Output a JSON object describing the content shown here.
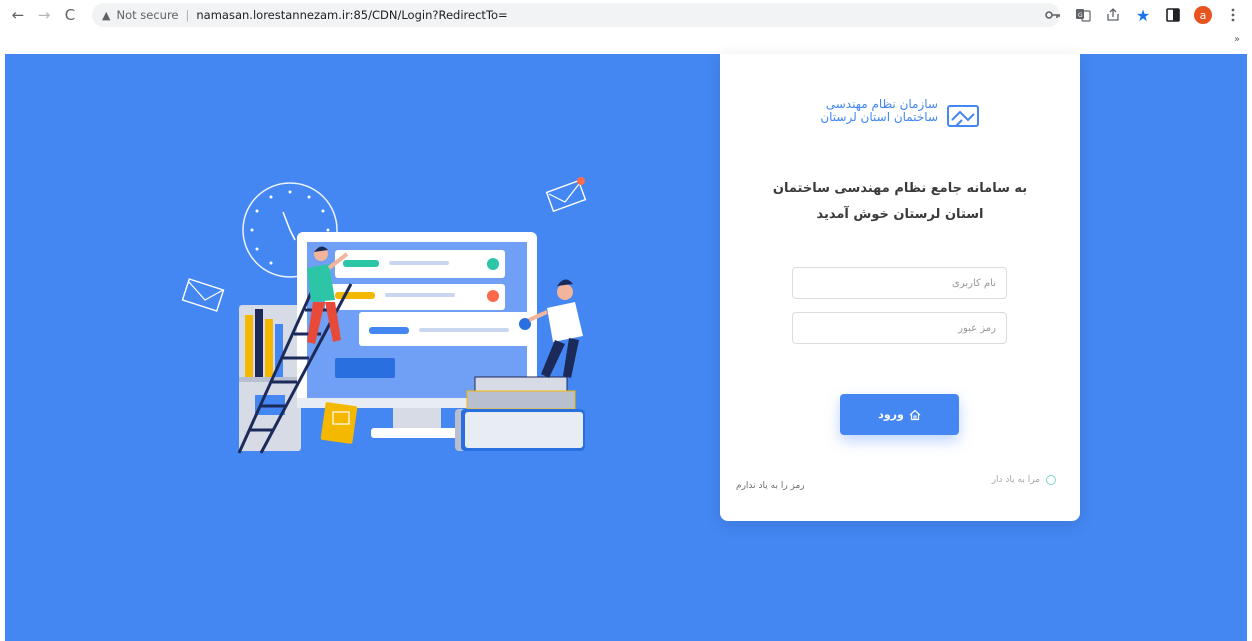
{
  "browser": {
    "back_icon": "←",
    "forward_icon": "→",
    "reload_icon": "C",
    "security_warning_icon": "▲",
    "security_label": "Not secure",
    "separator": "|",
    "url": "namasan.lorestannezam.ir:85/CDN/Login?RedirectTo=",
    "profile_initial": "a",
    "overflow_label": "»"
  },
  "brand": {
    "line1": "سازمان نظام مهندسی",
    "line2": "ساختمان استان لرستان",
    "color": "#4487f3"
  },
  "welcome": {
    "line1": "به سامانه جامع نظام مهندسی ساختمان",
    "line2": "استان لرستان خوش آمدید"
  },
  "login_form": {
    "username_placeholder": "نام کاربری",
    "username_value": "",
    "password_placeholder": "رمز عبور",
    "password_value": "",
    "submit_label": "ورود",
    "remember_label": "مرا به یاد دار",
    "remember_checked": false,
    "forgot_label": "رمز را به یاد ندارم"
  },
  "colors": {
    "background": "#4487f3",
    "card": "#ffffff",
    "primary_button": "#4487f3"
  }
}
